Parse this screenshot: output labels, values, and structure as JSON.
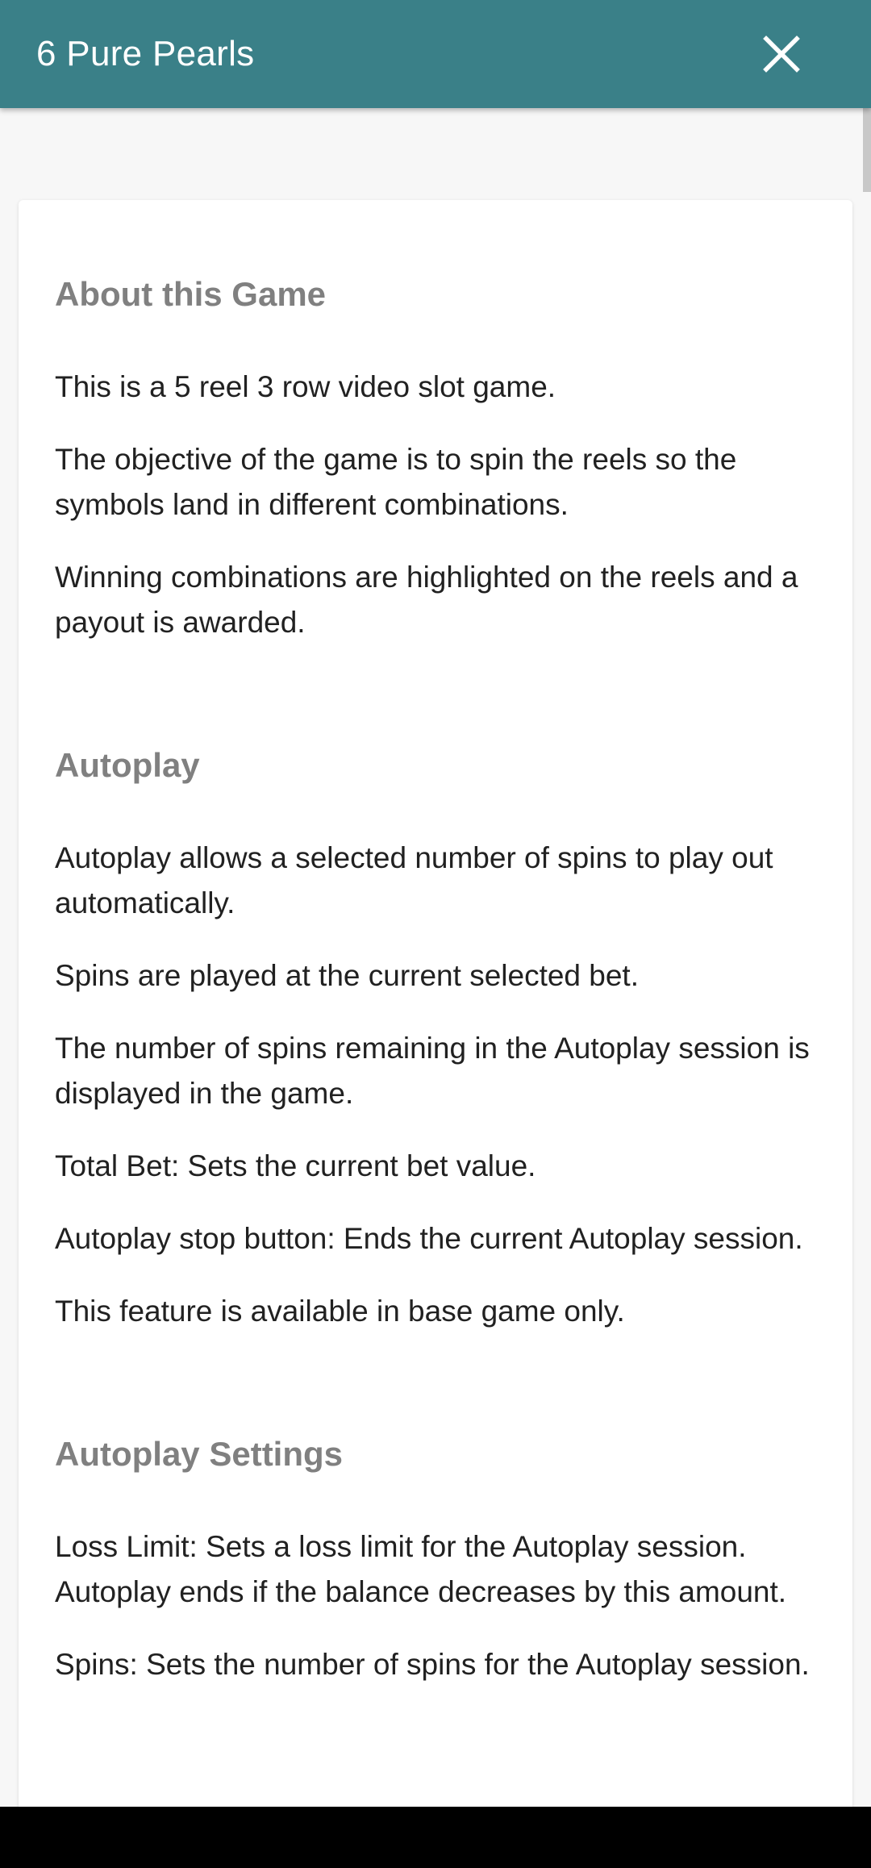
{
  "header": {
    "title": "6 Pure Pearls",
    "close_icon": "close-icon"
  },
  "sections": [
    {
      "heading": "About this Game",
      "paragraphs": [
        "This is a 5 reel 3 row video slot game.",
        "The objective of the game is to spin the reels so the symbols land in different combinations.",
        "Winning combinations are highlighted on the reels and a payout is awarded."
      ]
    },
    {
      "heading": "Autoplay",
      "paragraphs": [
        "Autoplay allows a selected number of spins to play out automatically.",
        "Spins are played at the current selected bet.",
        "The number of spins remaining in the Autoplay session is displayed in the game.",
        "Total Bet: Sets the current bet value.",
        "Autoplay stop button: Ends the current Autoplay session.",
        "This feature is available in base game only."
      ]
    },
    {
      "heading": "Autoplay Settings",
      "paragraphs": [
        "Loss Limit: Sets a loss limit for the Autoplay session. Autoplay ends if the balance decreases by this amount.",
        "Spins: Sets the number of spins for the Autoplay session."
      ]
    }
  ],
  "colors": {
    "header_bg": "#3a8088",
    "heading_text": "#808080",
    "body_text": "#212121",
    "page_bg": "#f7f7f7"
  }
}
